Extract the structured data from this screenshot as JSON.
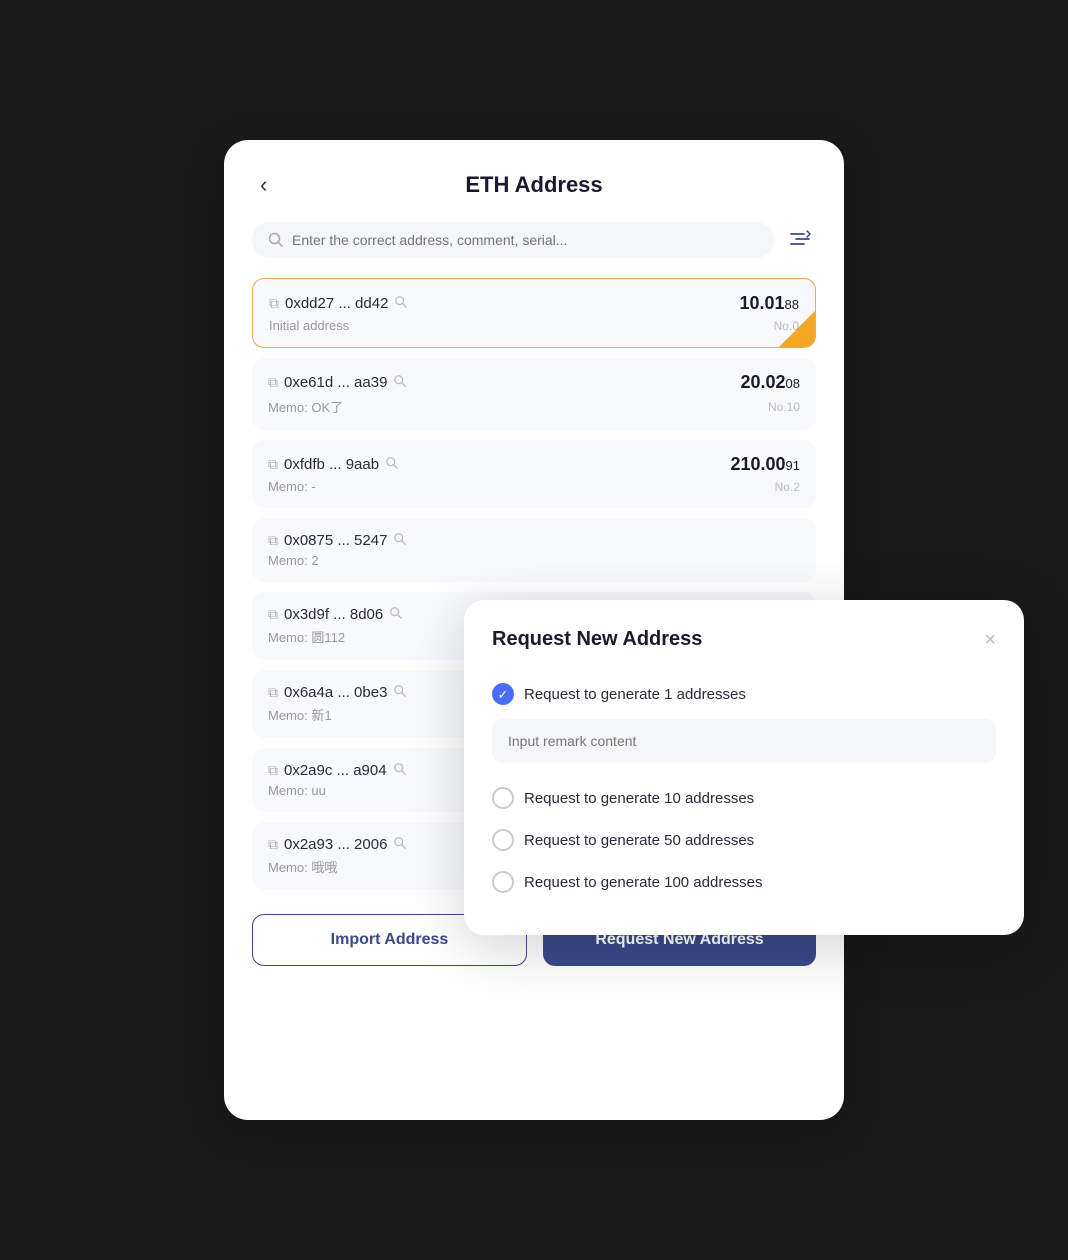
{
  "header": {
    "back_label": "‹",
    "title": "ETH Address"
  },
  "search": {
    "placeholder": "Enter the correct address, comment, serial..."
  },
  "filter_icon": "≡↕",
  "addresses": [
    {
      "address": "0xdd27 ... dd42",
      "memo": "Initial address",
      "amount_main": "10.01",
      "amount_decimal": "88",
      "no": "No.0",
      "active": true
    },
    {
      "address": "0xe61d ... aa39",
      "memo": "Memo: OK了",
      "amount_main": "20.02",
      "amount_decimal": "08",
      "no": "No.10",
      "active": false
    },
    {
      "address": "0xfdfb ... 9aab",
      "memo": "Memo: -",
      "amount_main": "210.00",
      "amount_decimal": "91",
      "no": "No.2",
      "active": false
    },
    {
      "address": "0x0875 ... 5247",
      "memo": "Memo: 2",
      "amount_main": "",
      "amount_decimal": "",
      "no": "",
      "active": false
    },
    {
      "address": "0x3d9f ... 8d06",
      "memo": "Memo: 圆112",
      "amount_main": "",
      "amount_decimal": "",
      "no": "",
      "active": false
    },
    {
      "address": "0x6a4a ... 0be3",
      "memo": "Memo: 新1",
      "amount_main": "",
      "amount_decimal": "",
      "no": "",
      "active": false
    },
    {
      "address": "0x2a9c ... a904",
      "memo": "Memo: uu",
      "amount_main": "",
      "amount_decimal": "",
      "no": "",
      "active": false
    },
    {
      "address": "0x2a93 ... 2006",
      "memo": "Memo: 哦哦",
      "amount_main": "",
      "amount_decimal": "",
      "no": "",
      "active": false
    }
  ],
  "buttons": {
    "import": "Import Address",
    "request": "Request New Address"
  },
  "modal": {
    "title": "Request New Address",
    "close_label": "×",
    "remark_placeholder": "Input remark content",
    "options": [
      {
        "label": "Request to generate 1 addresses",
        "checked": true
      },
      {
        "label": "Request to generate 10 addresses",
        "checked": false
      },
      {
        "label": "Request to generate 50 addresses",
        "checked": false
      },
      {
        "label": "Request to generate 100 addresses",
        "checked": false
      }
    ]
  }
}
